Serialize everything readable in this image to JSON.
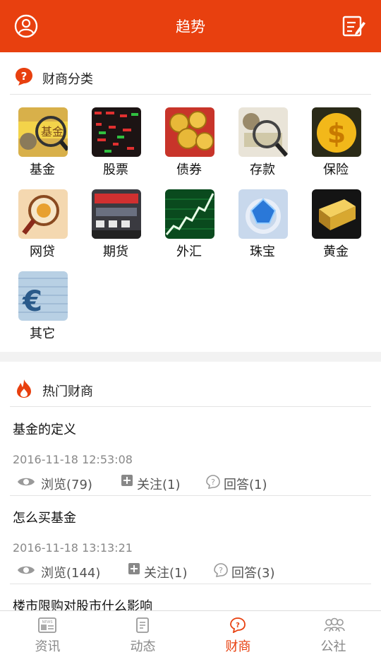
{
  "header": {
    "title": "趋势",
    "left_icon": "user-avatar-icon",
    "right_icon": "edit-note-icon",
    "color": "#e8400f"
  },
  "categories": {
    "heading": "财商分类",
    "items": [
      {
        "label": "基金",
        "icon": "fund-image"
      },
      {
        "label": "股票",
        "icon": "stock-image"
      },
      {
        "label": "债券",
        "icon": "bond-image"
      },
      {
        "label": "存款",
        "icon": "deposit-image"
      },
      {
        "label": "保险",
        "icon": "insurance-image"
      },
      {
        "label": "网贷",
        "icon": "p2p-loan-image"
      },
      {
        "label": "期货",
        "icon": "futures-image"
      },
      {
        "label": "外汇",
        "icon": "forex-image"
      },
      {
        "label": "珠宝",
        "icon": "jewelry-image"
      },
      {
        "label": "黄金",
        "icon": "gold-image"
      },
      {
        "label": "其它",
        "icon": "other-image"
      }
    ]
  },
  "hot": {
    "heading": "热门财商",
    "posts": [
      {
        "title": "基金的定义",
        "time": "2016-11-18 12:53:08",
        "views": "浏览(79)",
        "follows": "关注(1)",
        "answers": "回答(1)"
      },
      {
        "title": "怎么买基金",
        "time": "2016-11-18 13:13:21",
        "views": "浏览(144)",
        "follows": "关注(1)",
        "answers": "回答(3)"
      },
      {
        "title": "楼市限购对股市什么影响",
        "time": "",
        "views": "",
        "follows": "",
        "answers": ""
      }
    ]
  },
  "tabs": [
    {
      "label": "资讯",
      "icon": "news-icon",
      "active": false
    },
    {
      "label": "动态",
      "icon": "feed-icon",
      "active": false
    },
    {
      "label": "财商",
      "icon": "question-bubble-icon",
      "active": true
    },
    {
      "label": "公社",
      "icon": "community-icon",
      "active": false
    }
  ]
}
